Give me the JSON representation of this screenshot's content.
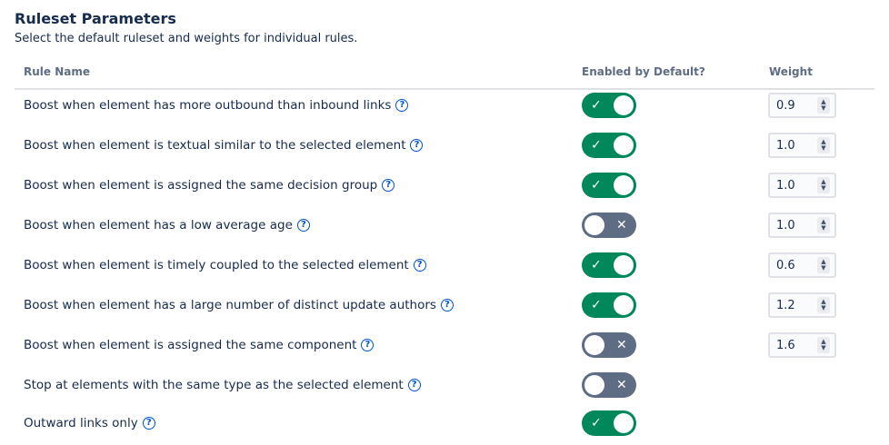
{
  "section": {
    "title": "Ruleset Parameters",
    "subtitle": "Select the default ruleset and weights for individual rules."
  },
  "table": {
    "headers": {
      "rule_name": "Rule Name",
      "enabled": "Enabled by Default?",
      "weight": "Weight"
    },
    "rows": [
      {
        "label": "Boost when element has more outbound than inbound links",
        "enabled": true,
        "weight": "0.9"
      },
      {
        "label": "Boost when element is textual similar to the selected element",
        "enabled": true,
        "weight": "1.0"
      },
      {
        "label": "Boost when element is assigned the same decision group",
        "enabled": true,
        "weight": "1.0"
      },
      {
        "label": "Boost when element has a low average age",
        "enabled": false,
        "weight": "1.0"
      },
      {
        "label": "Boost when element is timely coupled to the selected element",
        "enabled": true,
        "weight": "0.6"
      },
      {
        "label": "Boost when element has a large number of distinct update authors",
        "enabled": true,
        "weight": "1.2"
      },
      {
        "label": "Boost when element is assigned the same component",
        "enabled": false,
        "weight": "1.6"
      },
      {
        "label": "Stop at elements with the same type as the selected element",
        "enabled": false
      },
      {
        "label": "Outward links only",
        "enabled": true
      }
    ]
  },
  "icons": {
    "help": "question-circle-icon",
    "toggle_on": "check-icon",
    "toggle_off": "cross-icon",
    "stepper": "chevron-up-down-icon"
  },
  "colors": {
    "toggle_on": "#00875a",
    "toggle_off": "#5e6c84",
    "help_icon": "#0052cc",
    "text": "#172b4d",
    "header_text": "#5e6c84"
  }
}
